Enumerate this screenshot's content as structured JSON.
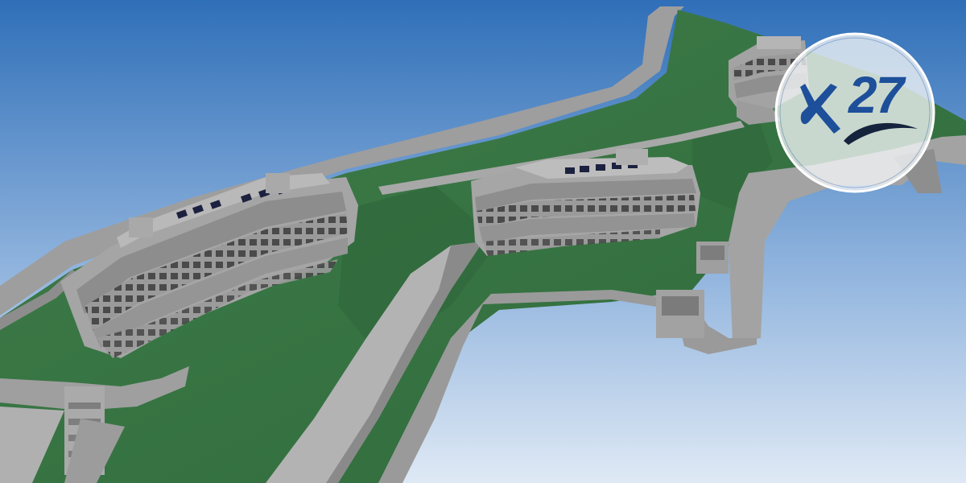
{
  "scene": {
    "description_type": "architectural-3d-render",
    "colors": {
      "sky_top": "#2f6fb8",
      "sky_bottom": "#dfe9f5",
      "terrain": "#3f7d4a",
      "terrain_dark": "#2f6a3b",
      "concrete": "#a7a7a7",
      "concrete_dark": "#7b7b7b",
      "window": "#4a4a4a",
      "solar": "#1c2140"
    }
  },
  "logo": {
    "number": "27",
    "icon": "ampersand-swoosh-logo-icon",
    "colors": {
      "primary": "#1d4f9a",
      "ring": "#ffffff",
      "fill": "#f2f5f6",
      "swoosh": "#15233d"
    }
  }
}
